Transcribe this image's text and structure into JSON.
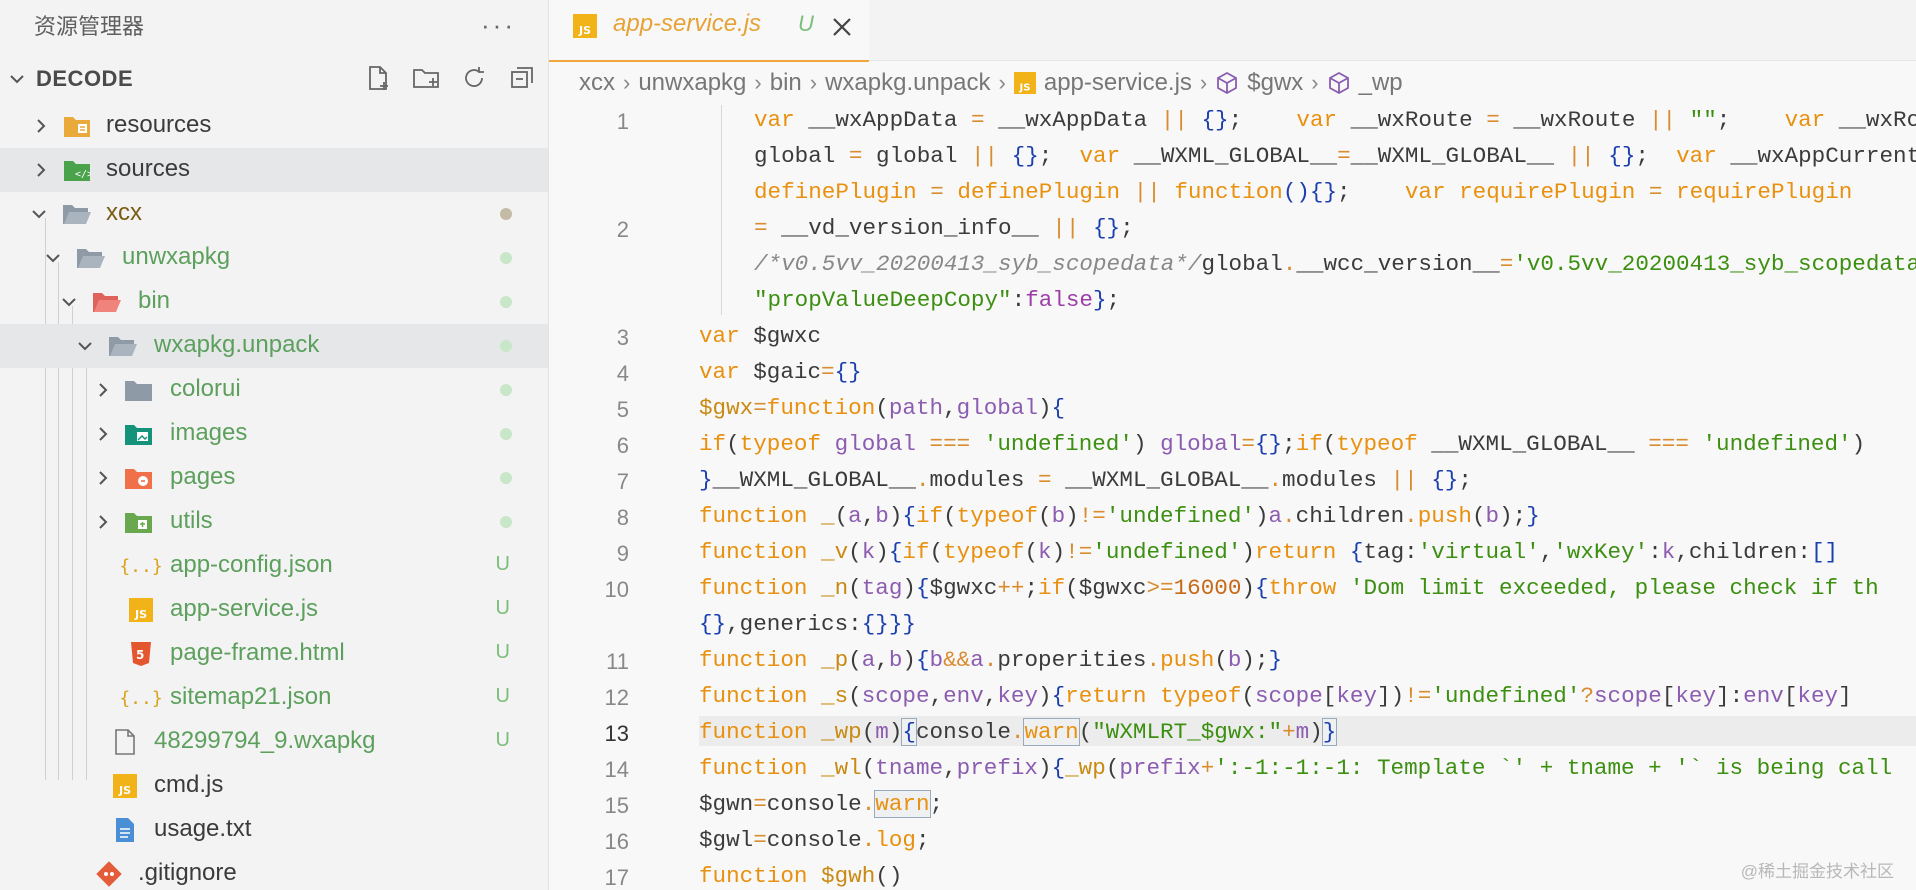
{
  "sidebar": {
    "title": "资源管理器",
    "more_label": "···",
    "section_title": "DECODE",
    "items": [
      {
        "label": "resources",
        "status": ""
      },
      {
        "label": "sources",
        "status": ""
      },
      {
        "label": "xcx",
        "status": ""
      },
      {
        "label": "unwxapkg",
        "status": ""
      },
      {
        "label": "bin",
        "status": ""
      },
      {
        "label": "wxapkg.unpack",
        "status": ""
      },
      {
        "label": "colorui",
        "status": ""
      },
      {
        "label": "images",
        "status": ""
      },
      {
        "label": "pages",
        "status": ""
      },
      {
        "label": "utils",
        "status": ""
      },
      {
        "label": "app-config.json",
        "status": "U"
      },
      {
        "label": "app-service.js",
        "status": "U"
      },
      {
        "label": "page-frame.html",
        "status": "U"
      },
      {
        "label": "sitemap21.json",
        "status": "U"
      },
      {
        "label": "48299794_9.wxapkg",
        "status": "U"
      },
      {
        "label": "cmd.js",
        "status": ""
      },
      {
        "label": "usage.txt",
        "status": ""
      },
      {
        "label": ".gitignore",
        "status": ""
      }
    ]
  },
  "tab": {
    "name": "app-service.js",
    "status": "U"
  },
  "breadcrumb": [
    "xcx",
    "unwxapkg",
    "bin",
    "wxapkg.unpack",
    "app-service.js",
    "$gwx",
    "_wp"
  ],
  "line_numbers": [
    "1",
    "2",
    "3",
    "4",
    "5",
    "6",
    "7",
    "8",
    "9",
    "10",
    "11",
    "12",
    "13",
    "14",
    "15",
    "16",
    "17"
  ],
  "watermark": "@稀土掘金技术社区",
  "colors": {
    "accent": "#e7a236",
    "untracked": "#6fb06f",
    "keyword": "#e9900e",
    "string": "#3c8f10"
  }
}
